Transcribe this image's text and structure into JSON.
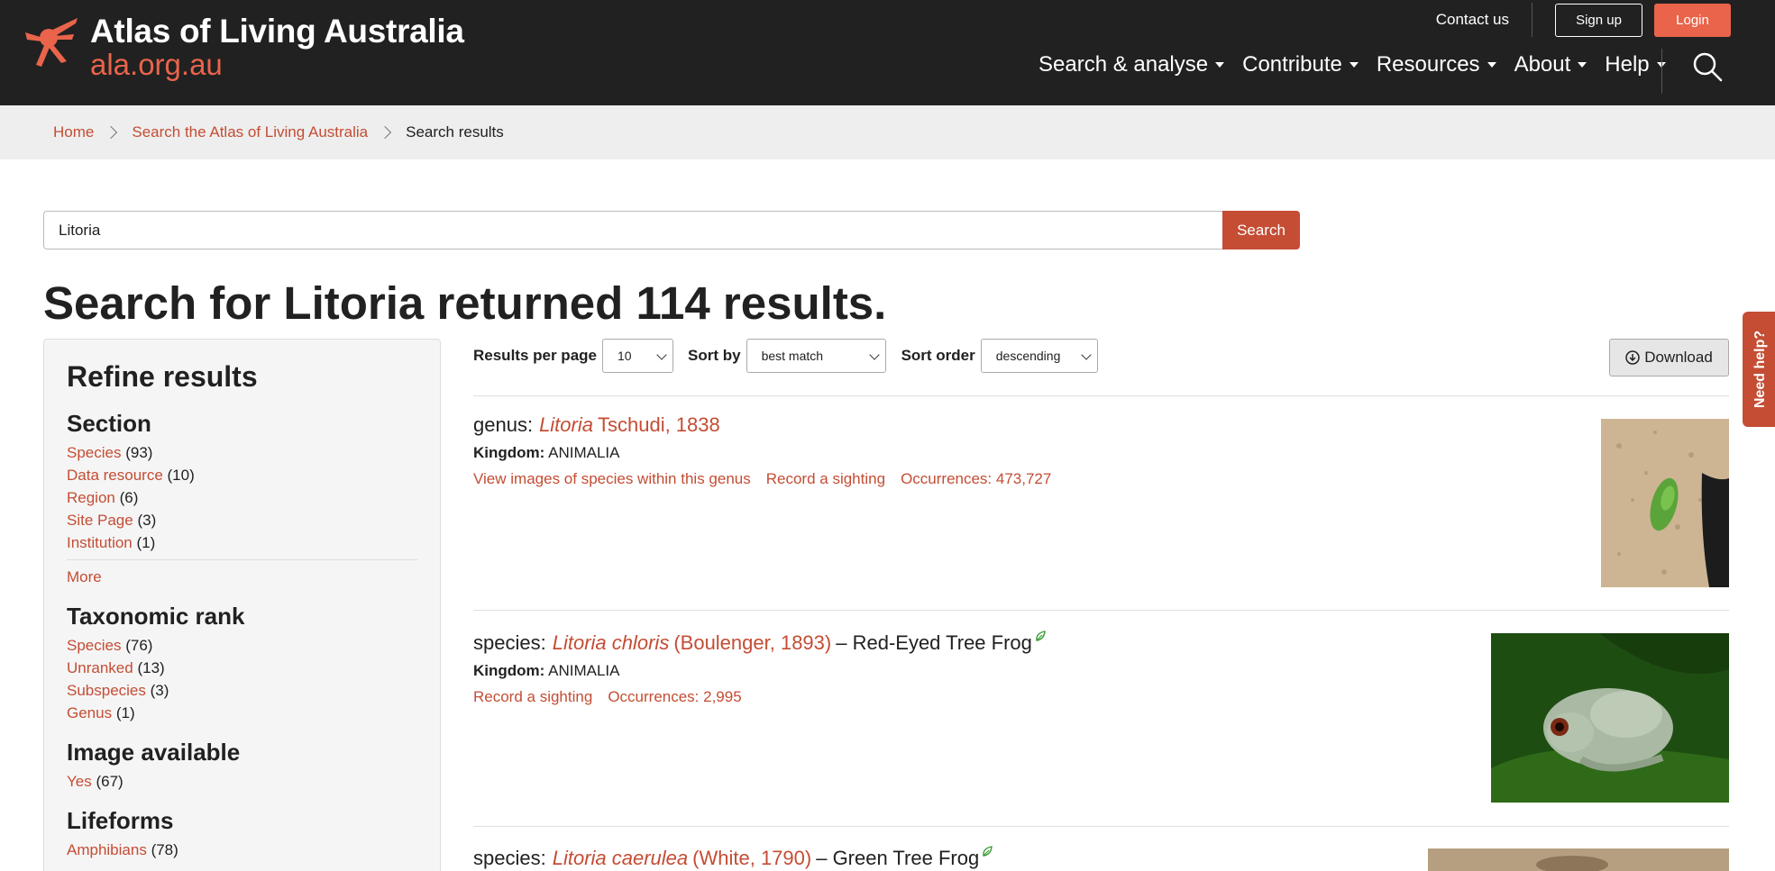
{
  "header": {
    "logo_title": "Atlas of Living Australia",
    "logo_url": "ala.org.au",
    "contact": "Contact us",
    "signup": "Sign up",
    "login": "Login",
    "nav": [
      "Search & analyse",
      "Contribute",
      "Resources",
      "About",
      "Help"
    ],
    "search_icon": "search-icon"
  },
  "breadcrumb": {
    "home": "Home",
    "search": "Search the Atlas of Living Australia",
    "current": "Search results"
  },
  "search": {
    "value": "Litoria",
    "button": "Search"
  },
  "page_title": "Search for Litoria returned 114 results.",
  "sidebar": {
    "title": "Refine results",
    "section": {
      "heading": "Section",
      "items": [
        {
          "label": "Species",
          "count": "(93)"
        },
        {
          "label": "Data resource",
          "count": "(10)"
        },
        {
          "label": "Region",
          "count": "(6)"
        },
        {
          "label": "Site Page",
          "count": "(3)"
        },
        {
          "label": "Institution",
          "count": "(1)"
        }
      ],
      "more": "More"
    },
    "rank": {
      "heading": "Taxonomic rank",
      "items": [
        {
          "label": "Species",
          "count": "(76)"
        },
        {
          "label": "Unranked",
          "count": "(13)"
        },
        {
          "label": "Subspecies",
          "count": "(3)"
        },
        {
          "label": "Genus",
          "count": "(1)"
        }
      ]
    },
    "image": {
      "heading": "Image available",
      "items": [
        {
          "label": "Yes",
          "count": "(67)"
        }
      ]
    },
    "lifeforms": {
      "heading": "Lifeforms",
      "items": [
        {
          "label": "Amphibians",
          "count": "(78)"
        }
      ]
    }
  },
  "controls": {
    "per_page_label": "Results per page",
    "per_page_value": "10",
    "sort_by_label": "Sort by",
    "sort_by_value": "best match",
    "sort_order_label": "Sort order",
    "sort_order_value": "descending",
    "download": "Download"
  },
  "results": [
    {
      "rank": "genus:",
      "sci": "Litoria",
      "author": "Tschudi, 1838",
      "common": "",
      "kingdom_label": "Kingdom:",
      "kingdom": "ANIMALIA",
      "links": [
        "View images of species within this genus",
        "Record a sighting",
        "Occurrences: 473,727"
      ]
    },
    {
      "rank": "species:",
      "sci": "Litoria chloris",
      "author": "(Boulenger, 1893)",
      "common": "– Red-Eyed Tree Frog",
      "kingdom_label": "Kingdom:",
      "kingdom": "ANIMALIA",
      "links": [
        "Record a sighting",
        "Occurrences: 2,995"
      ]
    },
    {
      "rank": "species:",
      "sci": "Litoria caerulea",
      "author": "(White, 1790)",
      "common": "– Green Tree Frog"
    }
  ],
  "need_help": "Need help?",
  "colors": {
    "header_bg": "#212121",
    "accent": "#c44d34",
    "logo_orange": "#e9644b"
  }
}
